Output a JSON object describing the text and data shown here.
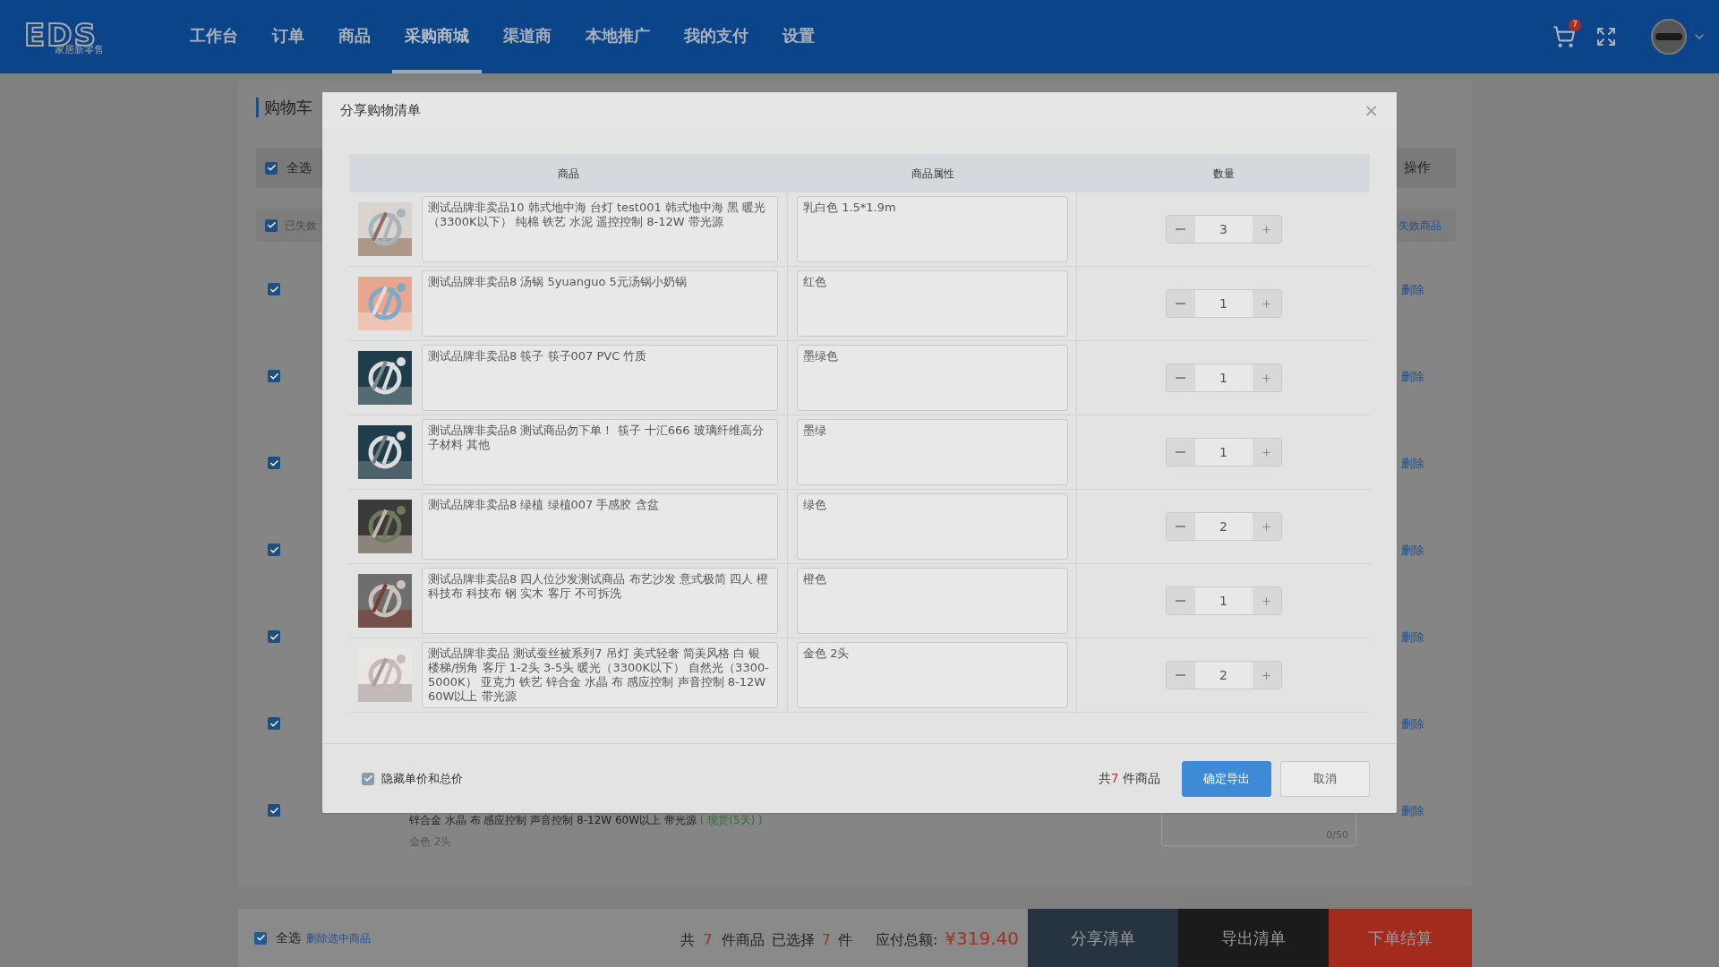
{
  "header": {
    "logo": {
      "letters": "EDS",
      "name": "家居新零售"
    },
    "nav": [
      {
        "label": "工作台",
        "selected": false
      },
      {
        "label": "订单",
        "selected": false
      },
      {
        "label": "商品",
        "selected": false
      },
      {
        "label": "采购商城",
        "selected": true
      },
      {
        "label": "渠道商",
        "selected": false
      },
      {
        "label": "本地推广",
        "selected": false
      },
      {
        "label": "我的支付",
        "selected": false
      },
      {
        "label": "设置",
        "selected": false
      }
    ],
    "cart_badge": "7"
  },
  "cart": {
    "title": "购物车",
    "select_all": {
      "label": "全选",
      "checked": true
    },
    "action_header": "操作",
    "invalid": {
      "label": "已失效",
      "checked": true,
      "clear_link": "失效商品"
    },
    "rows": [
      {
        "checked": true,
        "delete": "删除"
      },
      {
        "checked": true,
        "delete": "删除"
      },
      {
        "checked": true,
        "delete": "删除"
      },
      {
        "checked": true,
        "delete": "删除"
      },
      {
        "checked": true,
        "delete": "删除"
      },
      {
        "checked": true,
        "delete": "删除"
      },
      {
        "checked": true,
        "delete": "删除"
      }
    ],
    "last_row_visible": {
      "name": "锌合金 水晶 布 感应控制 声音控制 8-12W 60W以上 带光源",
      "stock": "( 现货(5天) )",
      "attribute": "金色 2头",
      "remark_count": "0/50"
    }
  },
  "modal": {
    "title": "分享购物清单",
    "close": "×",
    "columns": [
      "商品",
      "商品属性",
      "数量"
    ],
    "rows": [
      {
        "name": "测试品牌非卖品10 韩式地中海 台灯 test001 韩式地中海 黑 暖光（3300K以下） 纯棉 铁艺 水泥 遥控控制 8-12W 带光源",
        "attribute": "乳白色 1.5*1.9m",
        "quantity": "3"
      },
      {
        "name": "测试品牌非卖品8 汤锅 5yuanguo 5元汤锅小奶锅",
        "attribute": "红色",
        "quantity": "1"
      },
      {
        "name": "测试品牌非卖品8 筷子 筷子007 PVC 竹质",
        "attribute": "墨绿色",
        "quantity": "1"
      },
      {
        "name": "测试品牌非卖品8 测试商品勿下单！ 筷子 十汇666 玻璃纤维高分子材料 其他",
        "attribute": "墨绿",
        "quantity": "1"
      },
      {
        "name": "测试品牌非卖品8 绿植 绿植007 手感胶 含盆",
        "attribute": "绿色",
        "quantity": "2"
      },
      {
        "name": "测试品牌非卖品8 四人位沙发测试商品 布艺沙发  意式极简 四人 橙科技布 科技布 钢 实木 客厅 不可拆洗",
        "attribute": "橙色",
        "quantity": "1"
      },
      {
        "name": "测试品牌非卖品 测试蚕丝被系列7 吊灯  美式轻奢 简美风格 白 银楼梯/拐角 客厅 1-2头 3-5头 暖光（3300K以下） 自然光（3300-5000K） 亚克力 铁艺 锌合金 水晶 布 感应控制 声音控制 8-12W 60W以上 带光源",
        "attribute": "金色 2头",
        "quantity": "2"
      }
    ],
    "hide_prices": {
      "label": "隐藏单价和总价",
      "checked": true
    },
    "count_pre": "共",
    "count": "7",
    "count_post": " 件商品",
    "buttons": [
      {
        "label": "确定导出",
        "kind": "primary"
      },
      {
        "label": "取消",
        "kind": "secondary"
      }
    ]
  },
  "bottom_bar": {
    "select_all": {
      "label": "全选",
      "checked": true
    },
    "delete_selected": "删除选中商品",
    "total_pre": "共",
    "total_count": "7",
    "total_mid": "件商品",
    "selected_pre": "已选择",
    "selected_count": "7",
    "selected_post": "件",
    "amount_label": "应付总额:",
    "amount": "¥319.40",
    "buttons": [
      {
        "label": "分享清单",
        "kind": "share"
      },
      {
        "label": "导出清单",
        "kind": "export"
      },
      {
        "label": "下单结算",
        "kind": "checkout"
      }
    ]
  }
}
